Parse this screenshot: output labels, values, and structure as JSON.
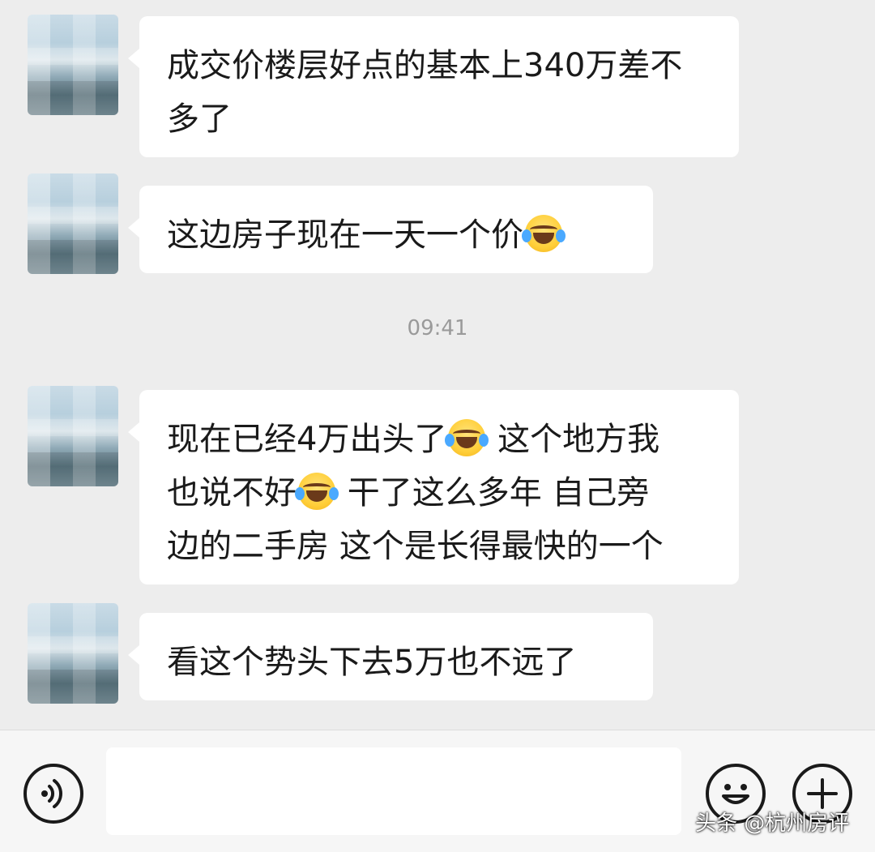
{
  "messages": [
    {
      "lines": [
        "成交价楼层好点的基本上340万差不",
        "多了"
      ]
    },
    {
      "line1_text": "这边房子现在一天一个价"
    },
    {
      "line1_a": "现在已经4万出头了",
      "line1_b": " 这个地方我",
      "line2_a": "也说不好",
      "line2_b": " 干了这么多年  自己旁",
      "line3": "边的二手房 这个是长得最快的一个"
    },
    {
      "text": "看这个势头下去5万也不远了"
    }
  ],
  "timestamp": "09:41",
  "emoji_name": "laugh-cry-emoji",
  "input": {
    "value": "",
    "placeholder": ""
  },
  "watermark": "头条 @杭州房评",
  "colors": {
    "background": "#ededed",
    "bubble": "#ffffff",
    "input_bar": "#f6f6f6"
  }
}
